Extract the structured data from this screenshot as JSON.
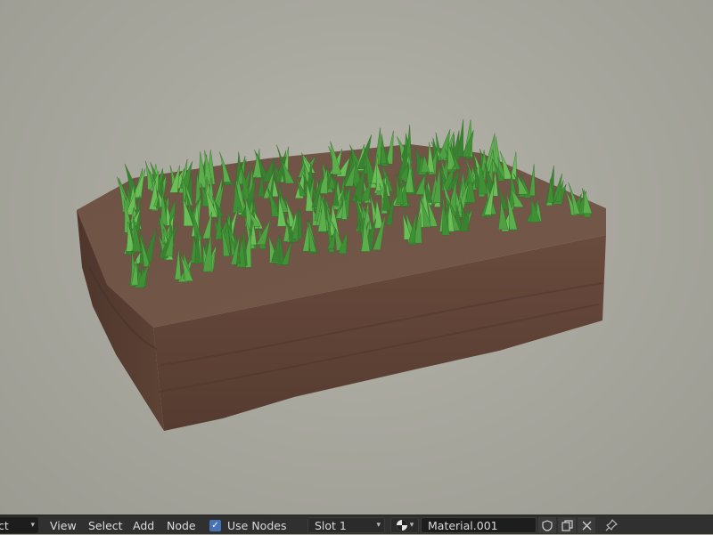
{
  "header": {
    "mode_label": "ct",
    "menus": {
      "view": "View",
      "select": "Select",
      "add": "Add",
      "node": "Node"
    },
    "use_nodes_label": "Use Nodes",
    "use_nodes_checked": true,
    "slot_label": "Slot 1",
    "material_name": "Material.001"
  },
  "icons": {
    "mode_dropdown": "chevron-down-icon",
    "use_nodes": "checkmark-icon",
    "slot_dropdown": "chevron-down-icon",
    "material_browse": "material-sphere-icon",
    "fake_user": "shield-icon",
    "duplicate": "duplicate-icon",
    "unlink": "close-icon",
    "pin": "pin-icon"
  },
  "colors": {
    "viewport_background": "#a9a89f",
    "header_background": "#303030",
    "accent_checkbox": "#4772b3",
    "soil_top": "#6b4f41",
    "soil_side": "#5c4134",
    "grass": "#4a9a3d"
  }
}
